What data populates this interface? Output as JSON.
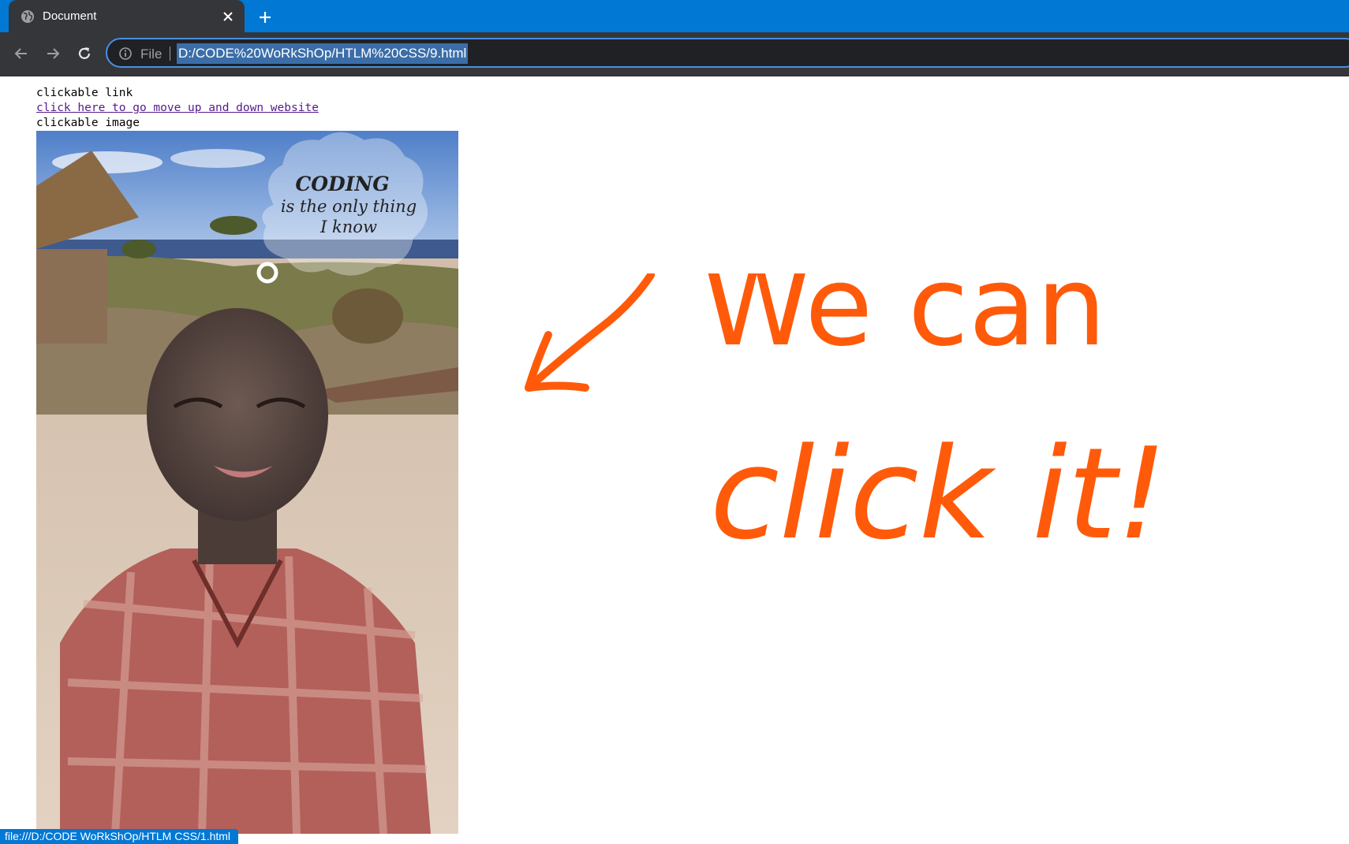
{
  "browser": {
    "tab_title": "Document",
    "url_scheme": "File",
    "url": "D:/CODE%20WoRkShOp/HTLM%20CSS/9.html",
    "status_url": "file:///D:/CODE WoRkShOp/HTLM CSS/1.html",
    "accent_color": "#0078d4"
  },
  "page": {
    "link_heading": "clickable link",
    "link_text": "click here to go move up and down website",
    "image_heading": "clickable image",
    "image_caption": {
      "line1": "CODING",
      "line2": "is the only thing",
      "line3": "I know"
    }
  },
  "annotation": {
    "line1": "We can",
    "line2": "click it!",
    "color": "#ff5a0a"
  }
}
